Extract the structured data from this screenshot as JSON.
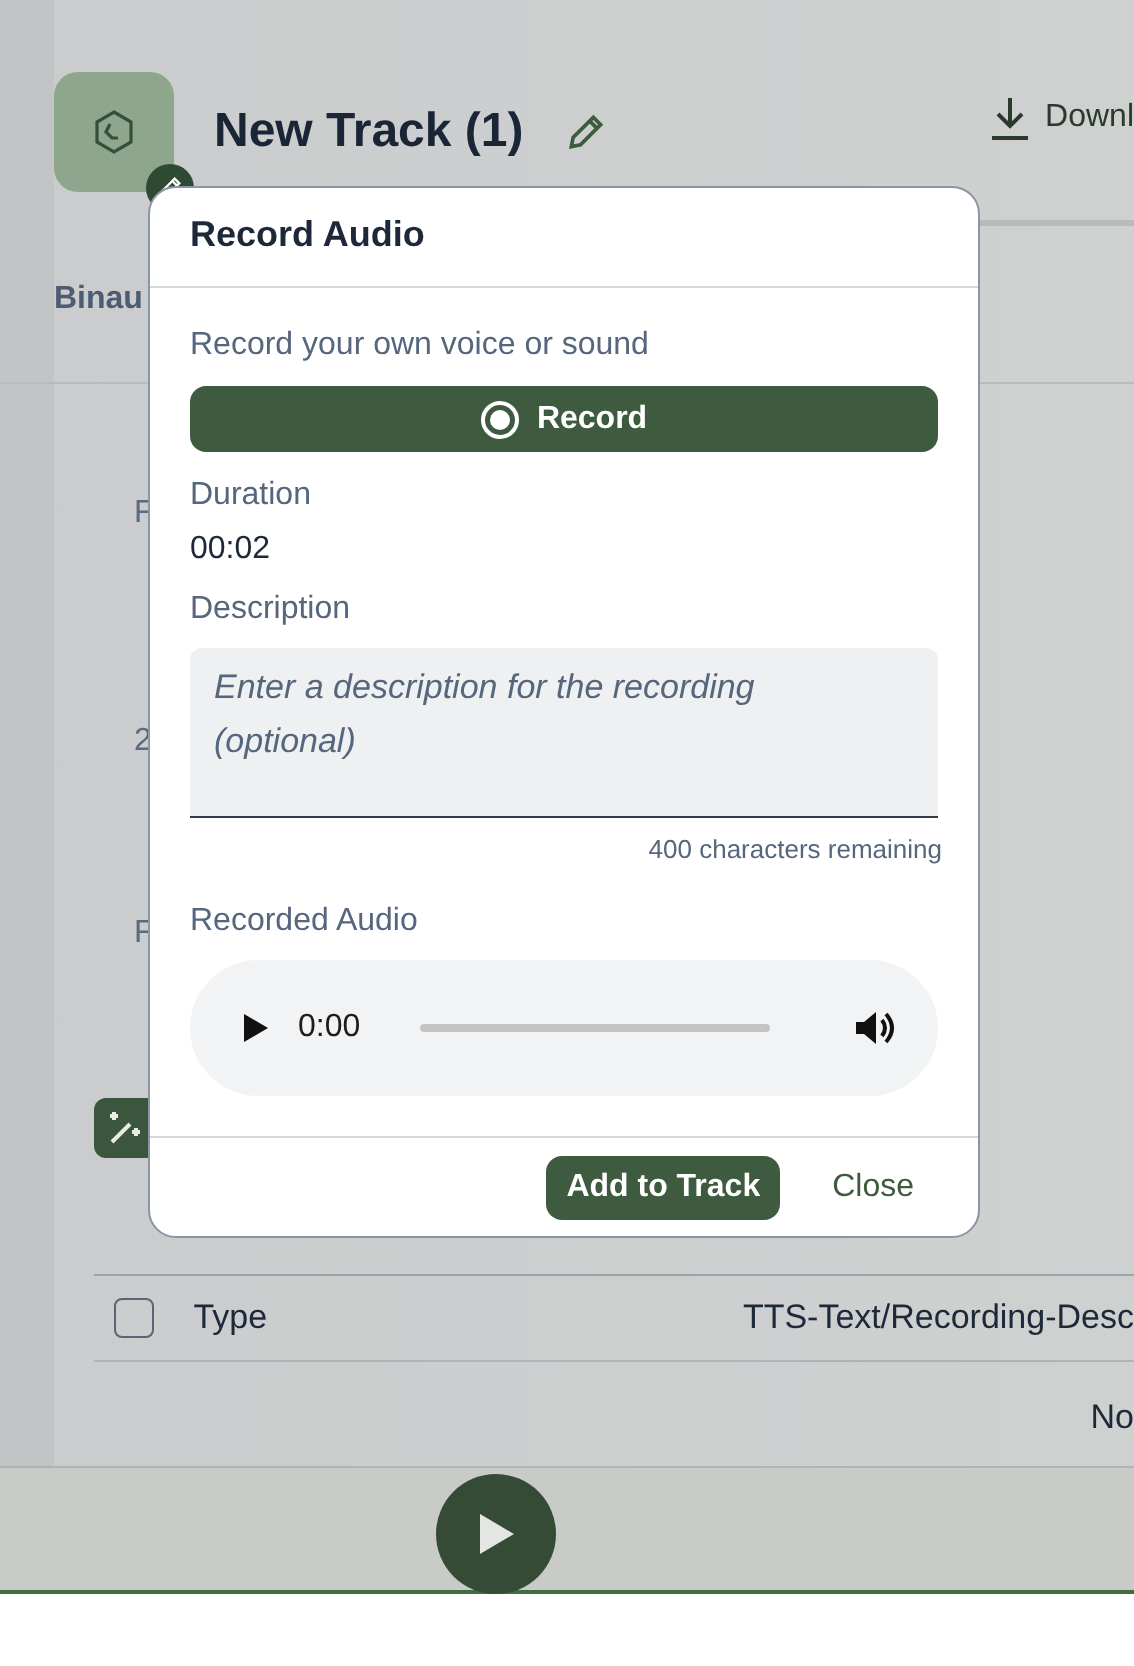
{
  "page": {
    "title": "New Track (1)",
    "download": "Downl",
    "tab": "Binau",
    "side_labels": [
      "F",
      "2",
      "F"
    ],
    "table": {
      "select_all": false,
      "columns": [
        "Type",
        "TTS-Text/Recording-Desc"
      ],
      "empty": "No"
    }
  },
  "dialog": {
    "title": "Record Audio",
    "intro": "Record your own voice or sound",
    "record_button": "Record",
    "duration_label": "Duration",
    "duration": "00:02",
    "description_label": "Description",
    "description": {
      "placeholder": "Enter a description for the recording (optional)"
    },
    "remaining": "400 characters remaining",
    "recorded_label": "Recorded Audio",
    "player": {
      "time": "0:00"
    },
    "buttons": [
      {
        "label": "Add to Track",
        "kind": "primary"
      },
      {
        "label": "Close",
        "kind": "text"
      }
    ]
  }
}
